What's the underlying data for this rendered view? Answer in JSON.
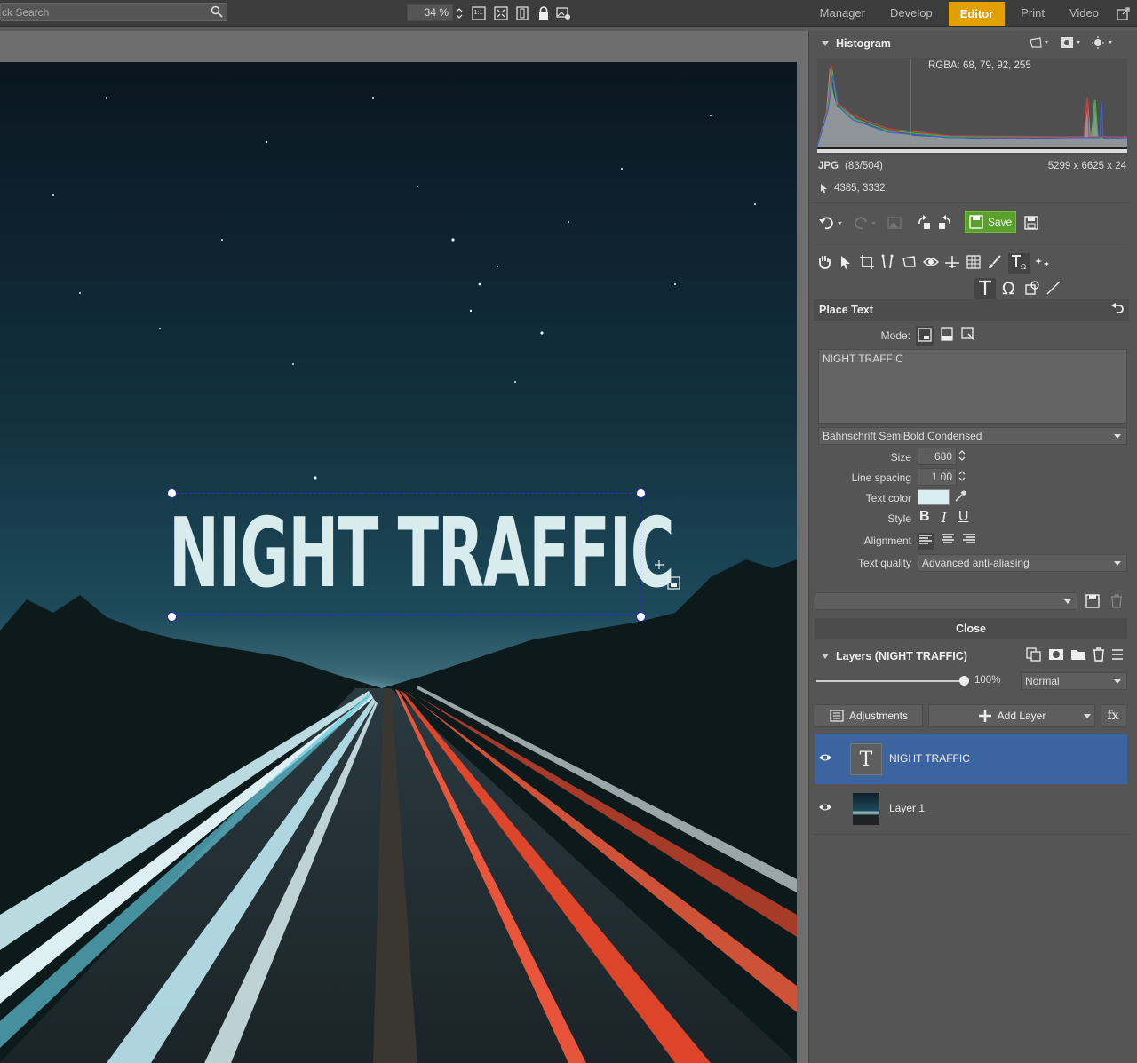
{
  "search": {
    "value": "ck Search"
  },
  "zoom": {
    "value": "34 %",
    "one_to_one": "1:1"
  },
  "modes": [
    "Manager",
    "Develop",
    "Editor",
    "Print",
    "Video"
  ],
  "active_mode": "Editor",
  "histogram": {
    "title": "Histogram",
    "rgba": "RGBA:  68,  79,  92, 255",
    "format": "JPG",
    "index": "(83/504)",
    "dimensions": "5299 x 6625 x 24",
    "cursor": "4385, 3332"
  },
  "toolbar": {
    "save_label": "Save"
  },
  "place_text": {
    "title": "Place Text",
    "mode_label": "Mode:",
    "text_value": "NIGHT TRAFFIC",
    "font": "Bahnschrift SemiBold Condensed",
    "size_label": "Size",
    "size_value": "680",
    "line_spacing_label": "Line spacing",
    "line_spacing_value": "1.00",
    "text_color_label": "Text color",
    "text_color": "#d8eef0",
    "style_label": "Style",
    "style_bold": "B",
    "style_italic": "I",
    "style_underline": "U",
    "alignment_label": "Alignment",
    "quality_label": "Text quality",
    "quality_value": "Advanced anti-aliasing",
    "close_label": "Close"
  },
  "layers": {
    "title": "Layers (NIGHT TRAFFIC)",
    "opacity": "100%",
    "opacity_fraction": 1.0,
    "blend_mode": "Normal",
    "adjustments_label": "Adjustments",
    "add_layer_label": "Add Layer",
    "fx_label": "fx",
    "items": [
      {
        "name": "NIGHT TRAFFIC",
        "type": "text",
        "selected": true,
        "thumb_glyph": "T"
      },
      {
        "name": "Layer 1",
        "type": "image",
        "selected": false
      }
    ]
  },
  "canvas": {
    "overlay_text": "NIGHT TRAFFIC"
  },
  "colors": {
    "accent": "#e0a000",
    "selection": "#3c64a0",
    "save_green": "#5aa02a"
  }
}
